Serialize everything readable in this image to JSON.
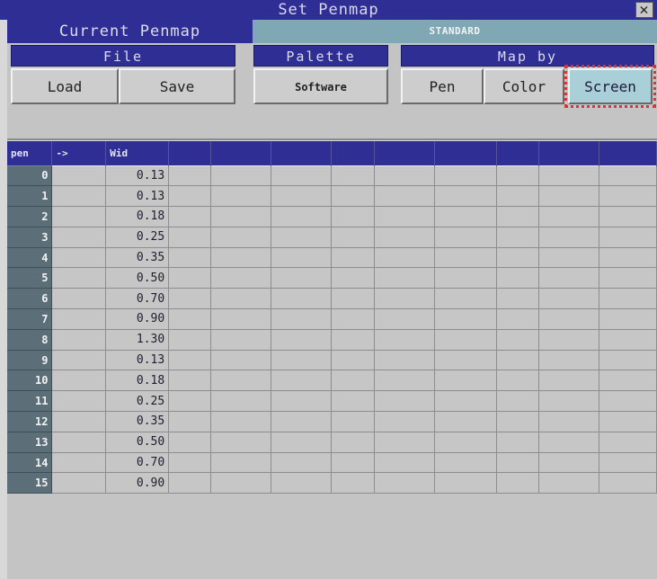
{
  "window": {
    "title": "Set Penmap",
    "close_icon": "close-icon"
  },
  "tabs": {
    "current_label": "Current Penmap",
    "standard_label": "STANDARD"
  },
  "file_group": {
    "header": "File",
    "load_label": "Load",
    "save_label": "Save"
  },
  "palette_group": {
    "header": "Palette",
    "software_label": "Software"
  },
  "mapby_group": {
    "header": "Map by",
    "pen_label": "Pen",
    "color_label": "Color",
    "screen_label": "Screen",
    "selected": "Screen"
  },
  "table": {
    "headers": [
      "pen",
      "->",
      "Wid",
      "",
      "",
      "",
      "",
      "",
      "",
      "",
      "",
      "",
      ""
    ],
    "rows": [
      {
        "pen": "0",
        "arrow": "",
        "wid": "0.13"
      },
      {
        "pen": "1",
        "arrow": "",
        "wid": "0.13"
      },
      {
        "pen": "2",
        "arrow": "",
        "wid": "0.18"
      },
      {
        "pen": "3",
        "arrow": "",
        "wid": "0.25"
      },
      {
        "pen": "4",
        "arrow": "",
        "wid": "0.35"
      },
      {
        "pen": "5",
        "arrow": "",
        "wid": "0.50"
      },
      {
        "pen": "6",
        "arrow": "",
        "wid": "0.70"
      },
      {
        "pen": "7",
        "arrow": "",
        "wid": "0.90"
      },
      {
        "pen": "8",
        "arrow": "",
        "wid": "1.30"
      },
      {
        "pen": "9",
        "arrow": "",
        "wid": "0.13"
      },
      {
        "pen": "10",
        "arrow": "",
        "wid": "0.18"
      },
      {
        "pen": "11",
        "arrow": "",
        "wid": "0.25"
      },
      {
        "pen": "12",
        "arrow": "",
        "wid": "0.35"
      },
      {
        "pen": "13",
        "arrow": "",
        "wid": "0.50"
      },
      {
        "pen": "14",
        "arrow": "",
        "wid": "0.70"
      },
      {
        "pen": "15",
        "arrow": "",
        "wid": "0.90"
      }
    ]
  },
  "colors": {
    "title_blue": "#2e2e94",
    "tab_teal": "#7fa8b4",
    "pen_column": "#5c6f78",
    "highlight": "#e23030"
  }
}
